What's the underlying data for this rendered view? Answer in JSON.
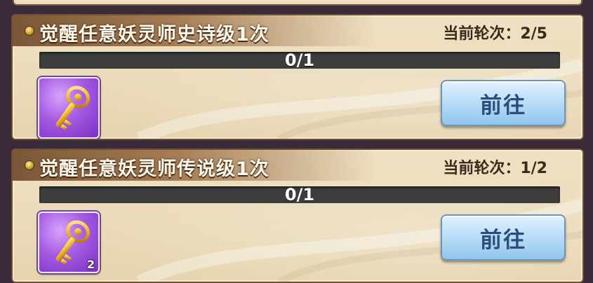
{
  "tasks": [
    {
      "title": "觉醒任意妖灵师史诗级1次",
      "round": "当前轮次：2/5",
      "progress_text": "0/1",
      "progress_fraction": 0,
      "reward": {
        "icon": "golden-key-icon",
        "qty": ""
      },
      "button": "前往"
    },
    {
      "title": "觉醒任意妖灵师传说级1次",
      "round": "当前轮次：1/2",
      "progress_text": "0/1",
      "progress_fraction": 0,
      "reward": {
        "icon": "golden-key-icon",
        "qty": "2"
      },
      "button": "前往"
    }
  ],
  "colors": {
    "item_bg": "#a45be0",
    "button_bg": "#b9dcf7",
    "header_band": "#7b5637"
  }
}
